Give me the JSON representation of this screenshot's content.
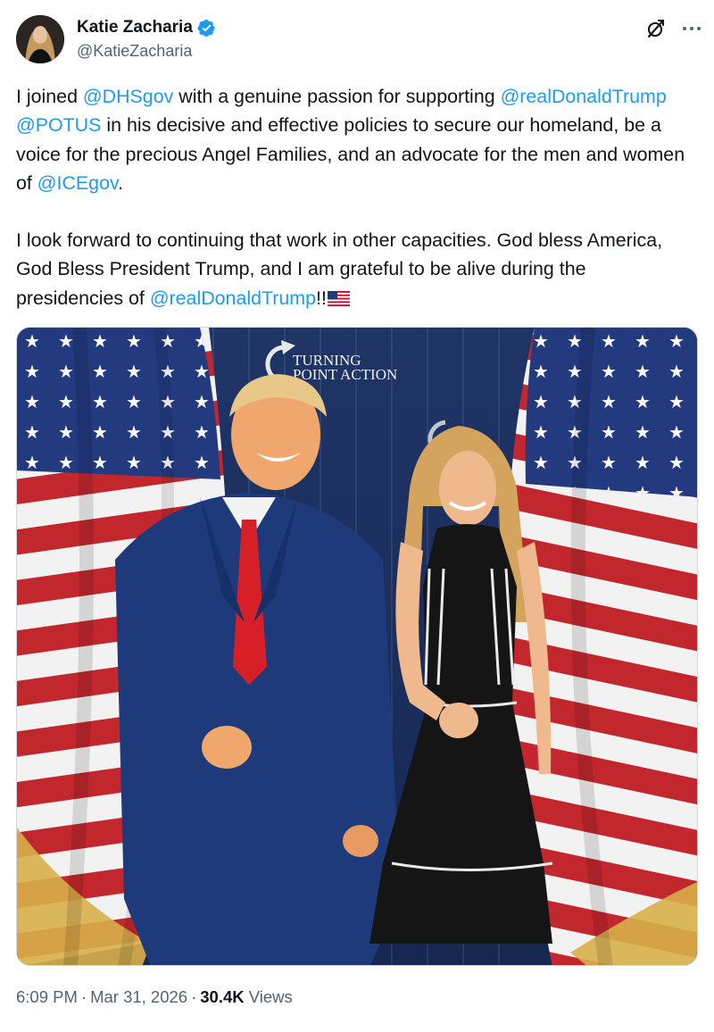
{
  "author": {
    "display_name": "Katie Zacharia",
    "handle": "@KatieZacharia",
    "verified_icon": "verified-badge-icon",
    "avatar_icon": "profile-avatar"
  },
  "header_actions": {
    "grok_icon": "grok-icon",
    "more_icon": "more-options-icon"
  },
  "tweet": {
    "p1": {
      "t1": "I joined ",
      "m1": "@DHSgov",
      "t2": " with a genuine passion for supporting ",
      "m2": "@realDonaldTrump",
      "t3": " ",
      "m3": "@POTUS",
      "t4": " in his decisive and effective policies to secure our homeland, be a voice for the precious Angel Families, and an advocate for the men and women of ",
      "m4": "@ICEgov",
      "t5": "."
    },
    "p2": {
      "t1": "I look forward to continuing that work in other capacities. God bless America, God Bless President Trump, and I am grateful to be alive during the presidencies of ",
      "m1": "@realDonaldTrump",
      "t2": "!!",
      "flag_icon": "us-flag-emoji"
    },
    "mention_color": "#1d9bf0"
  },
  "photo": {
    "backdrop_text_1": "TURNING",
    "backdrop_text_2": "POINT ACTION"
  },
  "footer": {
    "time": "6:09 PM",
    "separator": "·",
    "date": "Mar 31, 2026",
    "views_count": "30.4K",
    "views_label": "Views"
  }
}
